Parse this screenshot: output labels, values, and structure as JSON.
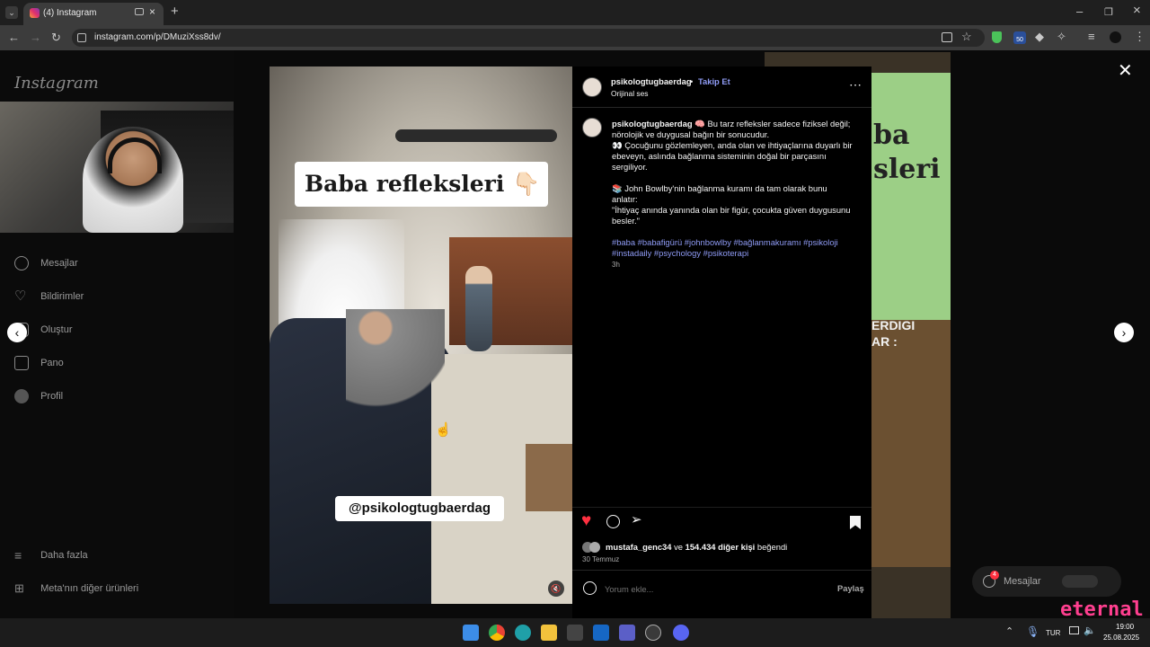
{
  "browser": {
    "tab_title": "(4) Instagram",
    "url": "instagram.com/p/DMuziXss8dv/"
  },
  "sidebar": {
    "logo": "Instagram",
    "items": [
      {
        "label": "Mesajlar",
        "icon": "messenger-icon"
      },
      {
        "label": "Bildirimler",
        "icon": "heart-icon"
      },
      {
        "label": "Oluştur",
        "icon": "plus-square-icon"
      },
      {
        "label": "Pano",
        "icon": "dashboard-icon"
      },
      {
        "label": "Profil",
        "icon": "avatar-icon"
      }
    ],
    "more": "Daha fazla",
    "meta": "Meta'nın diğer ürünleri"
  },
  "video": {
    "title_overlay": "Baba refleksleri 👇🏻",
    "handle_overlay": "@psikologtugbaerdag"
  },
  "post": {
    "username": "psikologtugbaerdag",
    "follow": "Takip Et",
    "audio": "Orijinal ses",
    "caption_lines": [
      "🧠 Bu tarz refleksler sadece fiziksel değil;",
      "nörolojik ve duygusal bağın bir sonucudur.",
      "👀 Çocuğunu gözlemleyen, anda olan ve ihtiyaçlarına duyarlı bir",
      "ebeveyn, aslında bağlanma sisteminin doğal bir parçasını",
      "sergiliyor.",
      "",
      "📚 John Bowlby'nin bağlanma kuramı da tam olarak bunu",
      "anlatır:",
      "\"İhtiyaç anında yanında olan bir figür, çocukta güven duygusunu",
      "besler.\""
    ],
    "hashtags_line1": "#baba #babafigürü #johnbowlby #bağlanmakuramı #psikoloji",
    "hashtags_line2": "#instadaily #psychology #psikoterapi",
    "time": "3h",
    "liked_by_user": "mustafa_genc34",
    "liked_and": "ve",
    "liked_count": "154.434 diğer kişi",
    "liked_suffix": "beğendi",
    "date": "30 Temmuz",
    "comment_placeholder": "Yorum ekle...",
    "share": "Paylaş"
  },
  "background_overlay": {
    "text_top": "ba",
    "text_mid": "sleri",
    "text_bottom1": "ERDIGI",
    "text_bottom2": "AR :"
  },
  "messages_widget": {
    "label": "Mesajlar",
    "badge": "4"
  },
  "taskbar": {
    "lang": "TUR",
    "time": "19:00",
    "date": "25.08.2025",
    "brand": "eternal"
  },
  "colors": {
    "accent_link": "#8f9bf5",
    "like_red": "#ff3040",
    "browser_bg": "#3c3c3c"
  }
}
